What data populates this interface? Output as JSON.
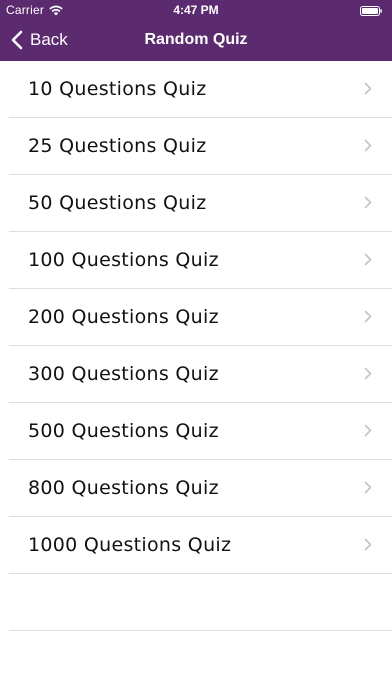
{
  "status_bar": {
    "carrier": "Carrier",
    "time": "4:47 PM",
    "wifi_icon": "wifi-icon",
    "battery_icon": "battery-icon"
  },
  "nav": {
    "back_label": "Back",
    "back_icon": "chevron-left-icon",
    "title": "Random Quiz"
  },
  "colors": {
    "header_background": "#5b2a6f",
    "header_text": "#ffffff",
    "list_background": "#ffffff",
    "separator": "#dedede",
    "chevron": "#c4c4c7"
  },
  "quiz_list": {
    "items": [
      {
        "label": "10 Questions Quiz"
      },
      {
        "label": "25 Questions Quiz"
      },
      {
        "label": "50 Questions Quiz"
      },
      {
        "label": "100 Questions Quiz"
      },
      {
        "label": "200 Questions Quiz"
      },
      {
        "label": "300 Questions Quiz"
      },
      {
        "label": "500 Questions Quiz"
      },
      {
        "label": "800 Questions Quiz"
      },
      {
        "label": "1000 Questions Quiz"
      }
    ],
    "row_icon": "chevron-right-icon"
  }
}
